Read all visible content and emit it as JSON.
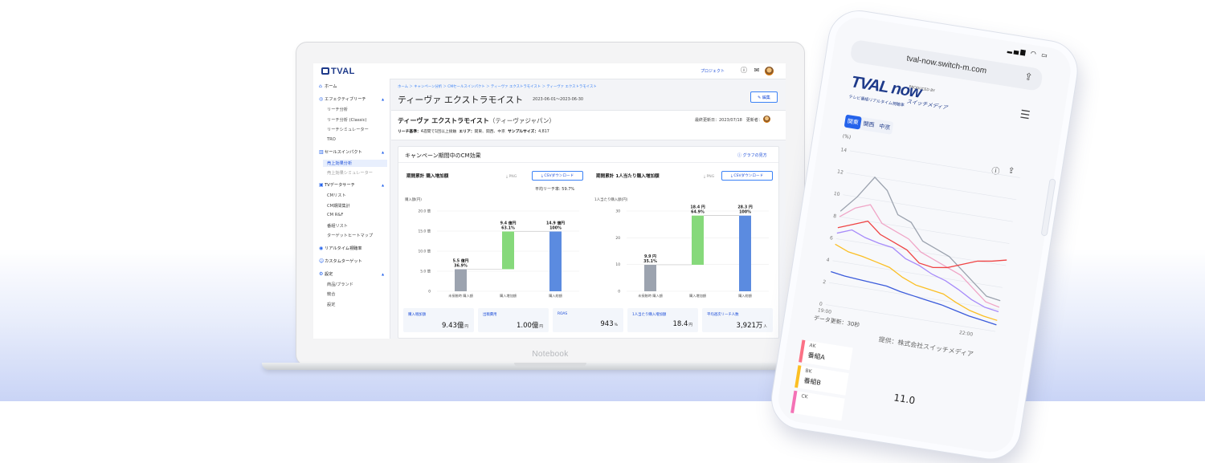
{
  "laptop": {
    "model_label": "Notebook",
    "logo": "TVAL",
    "topbar": {
      "project": "プロジェクト"
    },
    "sidebar": [
      {
        "label": "ホーム",
        "icon": "home-icon",
        "level": 0
      },
      {
        "label": "エフェクティブリーチ",
        "icon": "target-icon",
        "level": 0,
        "caret": "▲"
      },
      {
        "label": "リーチ分析",
        "level": 1
      },
      {
        "label": "リーチ分析 (Classic)",
        "level": 1
      },
      {
        "label": "リーチシミュレーター",
        "level": 1
      },
      {
        "label": "TRO",
        "level": 1
      },
      {
        "label": "セールスインパクト",
        "icon": "bar-chart-icon",
        "level": 0,
        "caret": "▲"
      },
      {
        "label": "売上効果分析",
        "level": 1,
        "active": true
      },
      {
        "label": "売上効果シミュレーター",
        "level": 1,
        "dim": true
      },
      {
        "label": "TVデータサーチ",
        "icon": "tv-icon",
        "level": 0,
        "caret": "▲"
      },
      {
        "label": "CMリスト",
        "level": 1
      },
      {
        "label": "CM期間集計",
        "level": 1
      },
      {
        "label": "CM R&F",
        "level": 1
      },
      {
        "label": "番組リスト",
        "level": 1
      },
      {
        "label": "ターゲットヒートマップ",
        "level": 1
      },
      {
        "label": "リアルタイム視聴率",
        "icon": "realtime-icon",
        "level": 0
      },
      {
        "label": "カスタムターゲット",
        "icon": "user-icon",
        "level": 0
      },
      {
        "label": "設定",
        "icon": "gear-icon",
        "level": 0,
        "caret": "▲"
      },
      {
        "label": "商品/ブランド",
        "level": 1
      },
      {
        "label": "競合",
        "level": 1
      },
      {
        "label": "設定",
        "level": 1
      }
    ],
    "breadcrumb": "ホーム ＞ キャンペーン分析 ＞ CMセールスインパクト ＞ ティーヴァ エクストラモイスト ＞ ティーヴァ エクストラモイスト",
    "page_title": "ティーヴァ エクストラモイスト",
    "page_date": "2023-06-01〜2023-06-30",
    "edit_label": "編集",
    "info": {
      "title": "ティーヴァ エクストラモイスト",
      "company": "（ティーヴァジャパン）",
      "updated": "最終更新日：2023/07/18　更新者：",
      "meta_reach_label": "リーチ基準：",
      "meta_reach": "4週間で1回以上接触",
      "meta_area_label": "エリア：",
      "meta_area": "関東、関西、中京",
      "meta_sample_label": "サンプルサイズ：",
      "meta_sample": "4,817"
    },
    "cm_card": {
      "title": "キャンペーン期間中のCM効果",
      "link": "グラフの見方"
    },
    "chart_png_label": "PNG",
    "chart_csv_label": "CSVダウンロード",
    "kpis": [
      {
        "label": "購入増加額",
        "value": "9.43億",
        "unit": "円"
      },
      {
        "label": "出稿費用",
        "value": "1.00億",
        "unit": "円"
      },
      {
        "label": "ROAS",
        "value": "943",
        "unit": "%"
      },
      {
        "label": "1人当たり購入増加額",
        "value": "18.4",
        "unit": "円"
      },
      {
        "label": "平均週次リーチ人数",
        "value": "3,921万",
        "unit": "人"
      }
    ]
  },
  "chart_data": [
    {
      "type": "bar",
      "title": "期間累計 購入増加額",
      "subtitle": "平均リーチ率: 59.7%",
      "ylabel": "購入額(円)",
      "ylim": [
        0,
        20
      ],
      "yticks": [
        "0",
        "5.0 億",
        "10.0 億",
        "15.0 億",
        "20.0 億"
      ],
      "ytick_values": [
        0,
        5,
        10,
        15,
        20
      ],
      "categories": [
        "未接触時 購入額",
        "購入増加額",
        "購入総額"
      ],
      "bars": [
        {
          "bottom": 0,
          "top": 5.5,
          "color": "#9ca3af",
          "label": "5.5 億円",
          "pct": "36.9%"
        },
        {
          "bottom": 5.5,
          "top": 14.9,
          "color": "#86d97b",
          "label": "9.4 億円",
          "pct": "63.1%"
        },
        {
          "bottom": 0,
          "top": 14.9,
          "color": "#5b8be0",
          "label": "14.9 億円",
          "pct": "100%"
        }
      ]
    },
    {
      "type": "bar",
      "title": "期間累計 1人当たり購入増加額",
      "ylabel": "1人当たり購入額(円)",
      "ylim": [
        0,
        30
      ],
      "yticks": [
        "0",
        "10",
        "20",
        "30"
      ],
      "ytick_values": [
        0,
        10,
        20,
        30
      ],
      "categories": [
        "未接触時 購入額",
        "購入増加額",
        "購入総額"
      ],
      "bars": [
        {
          "bottom": 0,
          "top": 9.9,
          "color": "#9ca3af",
          "label": "9.9 円",
          "pct": "35.1%"
        },
        {
          "bottom": 9.9,
          "top": 28.3,
          "color": "#86d97b",
          "label": "18.4 円",
          "pct": "64.9%"
        },
        {
          "bottom": 0,
          "top": 28.3,
          "color": "#5b8be0",
          "label": "28.3 円",
          "pct": "100%"
        }
      ]
    },
    {
      "type": "line",
      "ylim": [
        0,
        14
      ],
      "yticks": [
        "0",
        "2",
        "4",
        "6",
        "8",
        "10",
        "12",
        "14"
      ],
      "ytick_values": [
        0,
        2,
        4,
        6,
        8,
        10,
        12,
        14
      ],
      "x": [
        0,
        5,
        10,
        15,
        20,
        25,
        30,
        35,
        40,
        45,
        50,
        55,
        60
      ],
      "xticks": [
        "19:00",
        "",
        "",
        "",
        "",
        "",
        "",
        "",
        "",
        "",
        "22:00",
        "",
        ""
      ],
      "series": [
        {
          "color": "#9ca3af",
          "values": [
            8.5,
            10,
            12,
            11,
            9,
            8.5,
            7,
            6.5,
            6,
            5,
            4,
            3,
            2.8
          ]
        },
        {
          "color": "#f0a6c7",
          "values": [
            8,
            9,
            9.5,
            8,
            7.5,
            7,
            6,
            5.5,
            5,
            4.5,
            3.5,
            2.5,
            2.2
          ]
        },
        {
          "color": "#ef4444",
          "values": [
            7,
            7.5,
            8,
            7,
            6.5,
            6,
            5,
            4.8,
            5,
            5.5,
            6,
            6.2,
            6.5
          ]
        },
        {
          "color": "#a78bfa",
          "values": [
            6.5,
            7,
            6.5,
            6.2,
            6,
            5.2,
            4.8,
            4.2,
            3.8,
            3.2,
            2.5,
            2,
            1.8
          ]
        },
        {
          "color": "#fbbf24",
          "values": [
            5.5,
            5,
            4.8,
            4.5,
            4.2,
            3.5,
            3,
            2.8,
            2.6,
            2,
            1.5,
            1.2,
            1
          ]
        },
        {
          "color": "#3b5bdb",
          "values": [
            3,
            2.8,
            2.7,
            2.6,
            2.5,
            2.2,
            2,
            1.8,
            1.6,
            1.3,
            1,
            0.8,
            0.6
          ]
        }
      ]
    }
  ],
  "phone": {
    "url": "tval-now.switch-m.com",
    "logo": "TVAL now",
    "logo_sub": "テレビ番組リアルタイム視聴率",
    "produced_by": "PRODUCED BY",
    "company": "スイッチメディア",
    "tabs": [
      "関東",
      "関西",
      "中京"
    ],
    "unit": "(%)",
    "updated": "データ更新：30秒",
    "credit": "提供：株式会社スイッチメディア",
    "legends": [
      {
        "label": "AK",
        "name": "番組A",
        "color": "#fb7185"
      },
      {
        "label": "BK",
        "name": "番組B",
        "color": "#fbbf24"
      },
      {
        "label": "CK",
        "name": "",
        "color": "#f472b6"
      }
    ],
    "big_value": "11.0"
  }
}
